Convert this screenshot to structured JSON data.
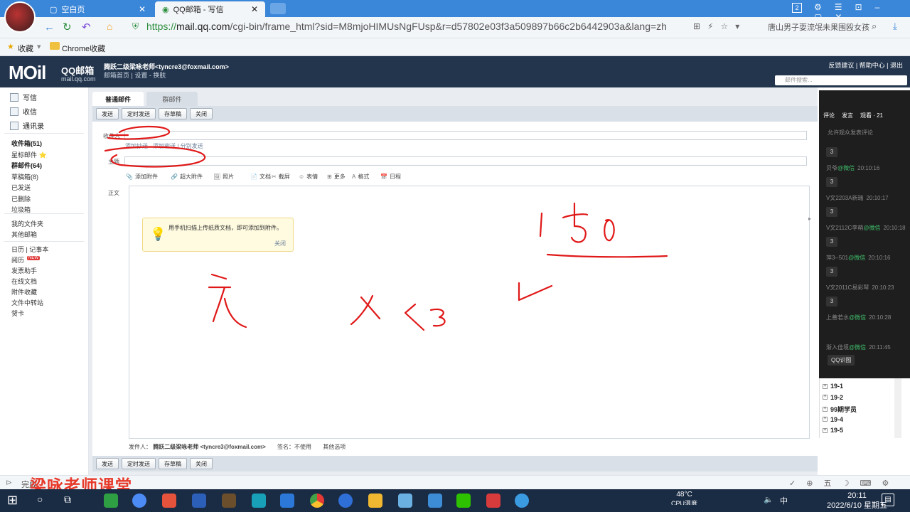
{
  "browser": {
    "tabs": [
      {
        "title": "空白页"
      },
      {
        "title": "QQ邮箱 - 写信"
      }
    ],
    "url_prefix": "https://",
    "url_host": "mail.qq.com",
    "url_path": "/cgi-bin/frame_html?sid=M8mjoHIMUsNgFUsp&r=d57802e03f3a509897b66c2b6442903a&lang=zh",
    "search_text": "唐山男子耍流氓未果围殴女孩",
    "badge": "2"
  },
  "bookmarks": {
    "fav": "收藏",
    "folder": "Chrome收藏"
  },
  "mail_header": {
    "logo": "MOil",
    "logo_title": "QQ邮箱",
    "logo_sub": "mail.qq.com",
    "user": "腾跃二级梁咏老师<tyncre3@foxmail.com>",
    "links": "邮箱首页 | 设置 - 换肤",
    "top_links": "反馈建议 | 帮助中心 | 退出",
    "search_placeholder": "邮件搜索..."
  },
  "sidebar": {
    "write": "写信",
    "inbox": "收信",
    "contacts": "通讯录",
    "items": [
      {
        "label": "收件箱(51)",
        "bold": true
      },
      {
        "label": "星标邮件 ⭐",
        "bold": false
      },
      {
        "label": "群邮件(64)",
        "bold": true
      },
      {
        "label": "草稿箱(8)",
        "bold": false
      },
      {
        "label": "已发送",
        "bold": false
      },
      {
        "label": "已删除",
        "bold": false
      },
      {
        "label": "垃圾箱",
        "bold": false
      }
    ],
    "my_folders": "我的文件夹",
    "other_mail": "其他邮箱",
    "calendar": "日历 | 记事本",
    "extra": [
      "阅历",
      "发票助手",
      "在线文档",
      "附件收藏",
      "文件中转站",
      "贺卡"
    ],
    "new_badge": "NEW"
  },
  "compose": {
    "tab_normal": "普通邮件",
    "tab_group": "群邮件",
    "buttons": [
      "发送",
      "定时发送",
      "存草稿",
      "关闭"
    ],
    "to_label": "收件人",
    "add_links": "添加抄送 - 添加密送 | 分别发送",
    "subject_label": "主题",
    "body_label": "正文",
    "toolbar": [
      "添加附件",
      "超大附件",
      "照片",
      "文档",
      "截屏",
      "表情",
      "更多",
      "格式",
      "日程"
    ],
    "tip_text": "用手机扫描上传纸质文档，即可添加到附件。",
    "tip_close": "关闭",
    "sender_label": "发件人：",
    "sender": "腾跃二级梁咏老师 <tyncre3@foxmail.com>",
    "signature": "签名：不使用",
    "other_options": "其他选项"
  },
  "live_panel": {
    "tabs": [
      "评论",
      "发言",
      "观看 · 21"
    ],
    "allow": "允许观众发表评论",
    "comments": [
      {
        "num": "3",
        "user": "贝爷",
        "via": "@微信",
        "time": "20:10:16"
      },
      {
        "num": "3",
        "user": "V文2203A新瑞",
        "via": "",
        "time": "20:10:17"
      },
      {
        "num": "3",
        "user": "V文2112C李萌",
        "via": "@微信",
        "time": "20:10:18"
      },
      {
        "num": "3",
        "user": "萍3--501",
        "via": "@微信",
        "time": "20:10:16"
      },
      {
        "num": "3",
        "user": "V文2011C易彩琴",
        "via": "",
        "time": "20:10:23"
      },
      {
        "num": "3",
        "user": "上善若水",
        "via": "@微信",
        "time": "20:10:28"
      },
      {
        "num": "",
        "user": "渐入佳境",
        "via": "@微信",
        "time": "20:11:45"
      }
    ],
    "qq_button": "QQ识图"
  },
  "right_list": [
    "19-1",
    "19-2",
    "99期学员",
    "19-4",
    "19-5"
  ],
  "status": {
    "left": "完成"
  },
  "watermark": "梁咏老师课堂",
  "taskbar": {
    "temp": "48°C",
    "temp_label": "CPU温度",
    "lang": "中",
    "time": "20:11",
    "date": "2022/6/10 星期五"
  },
  "ink_text": "150",
  "colors": {
    "accent": "#3a86d8",
    "header": "#23354d",
    "ink": "#e01818"
  }
}
